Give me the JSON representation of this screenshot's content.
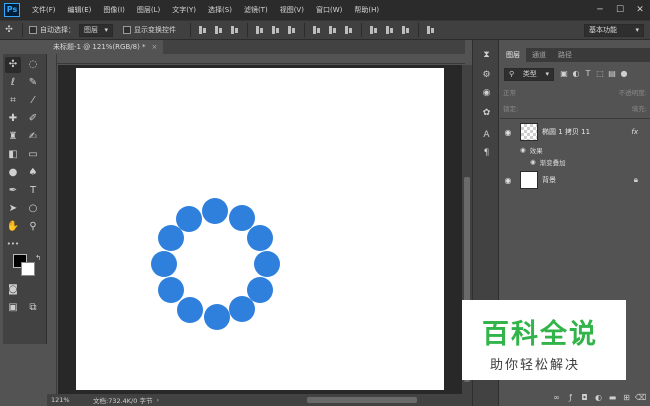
{
  "app": {
    "logo": "Ps"
  },
  "menu": [
    "文件(F)",
    "编辑(E)",
    "图像(I)",
    "图层(L)",
    "文字(Y)",
    "选择(S)",
    "滤镜(T)",
    "视图(V)",
    "窗口(W)",
    "帮助(H)"
  ],
  "window_controls": {
    "minimize": "─",
    "maximize": "☐",
    "close": "✕"
  },
  "options_bar": {
    "auto_select_label": "自动选择：",
    "auto_select_value": "图层",
    "show_transform_label": "显示变换控件",
    "workspace": "基本功能"
  },
  "document": {
    "tab_title": "未标题-1 @ 121%(RGB/8) *",
    "close": "×"
  },
  "status": {
    "zoom": "121%",
    "doc_info": "文档:732.4K/0 字节"
  },
  "colors": {
    "accent_dot": "#2f7fdc",
    "foreground": "#000000",
    "background": "#ffffff",
    "watermark_green": "#32b44a"
  },
  "layers_panel": {
    "tabs": [
      "图层",
      "通道",
      "路径"
    ],
    "filter_type": "类型",
    "blend_mode": "正常",
    "opacity_label": "不透明度:",
    "lock_label": "锁定:",
    "fill_label": "填充:",
    "layers": [
      {
        "name": "椭圆 1 拷贝 11",
        "fx": "fx",
        "effects_label": "效果",
        "effects": [
          "渐变叠加"
        ]
      },
      {
        "name": "背景"
      }
    ]
  },
  "watermark": {
    "title": "百科全说",
    "subtitle": "助你轻松解决"
  }
}
